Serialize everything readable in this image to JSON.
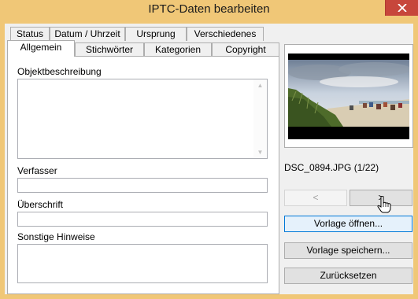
{
  "window": {
    "title": "IPTC-Daten bearbeiten"
  },
  "tabs_back": [
    {
      "label": "Status"
    },
    {
      "label": "Datum / Uhrzeit"
    },
    {
      "label": "Ursprung"
    },
    {
      "label": "Verschiedenes"
    }
  ],
  "tabs_front": [
    {
      "label": "Allgemein",
      "active": true
    },
    {
      "label": "Stichwörter"
    },
    {
      "label": "Kategorien"
    },
    {
      "label": "Copyright"
    }
  ],
  "form": {
    "description_label": "Objektbeschreibung",
    "description_value": "",
    "author_label": "Verfasser",
    "author_value": "",
    "headline_label": "Überschrift",
    "headline_value": "",
    "notes_label": "Sonstige Hinweise",
    "notes_value": ""
  },
  "preview": {
    "filename": "DSC_0894.JPG (1/22)",
    "prev_label": "<",
    "next_label": ">"
  },
  "buttons": {
    "open_template": "Vorlage öffnen...",
    "save_template": "Vorlage speichern...",
    "reset": "Zurücksetzen"
  },
  "colors": {
    "titlebar": "#f0c777",
    "close": "#c7463b",
    "dialog_bg": "#f0f0f0",
    "hover_border": "#0078d7"
  }
}
